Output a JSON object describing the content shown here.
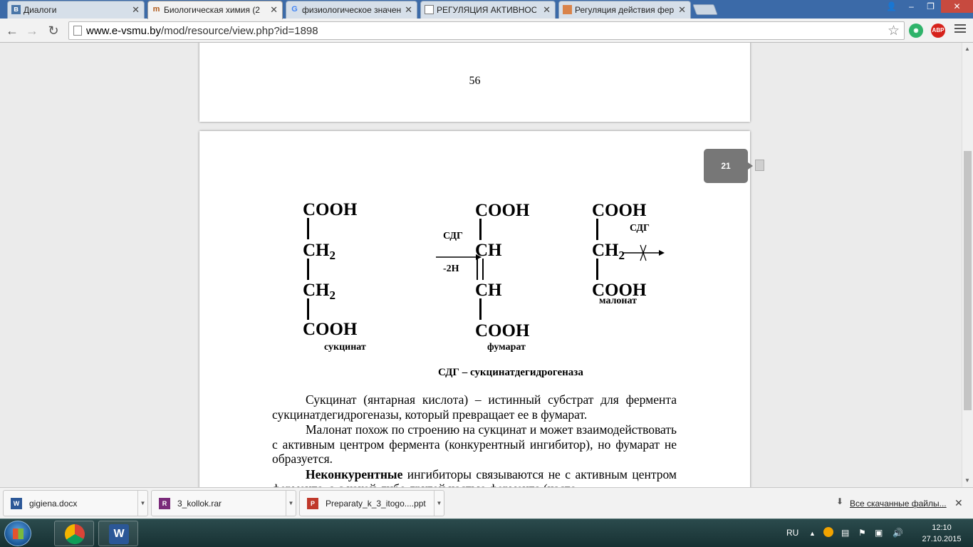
{
  "browser": {
    "tabs": [
      {
        "label": "Диалоги",
        "favicon": "vk-icon",
        "active": false
      },
      {
        "label": "Биологическая химия (2",
        "favicon": "moodle-icon",
        "active": true
      },
      {
        "label": "физиологическое значен",
        "favicon": "google-icon",
        "active": false
      },
      {
        "label": "РЕГУЛЯЦИЯ АКТИВНОСТ",
        "favicon": "document-icon",
        "active": false
      },
      {
        "label": "Регуляция действия фер",
        "favicon": "slides-icon",
        "active": false
      }
    ],
    "url_host": "www.e-vsmu.by",
    "url_path": "/mod/resource/view.php?id=1898",
    "ext_abp": "ABP",
    "window_controls": {
      "user": "👤",
      "minimize": "–",
      "maximize": "❐",
      "close": "✕"
    }
  },
  "document": {
    "prev_page_number": "56",
    "slide_badge": "21",
    "succinate": {
      "line1": "COOH",
      "line2": "CH",
      "line3": "CH",
      "line4": "COOH",
      "sub": "2",
      "label": "сукцинат"
    },
    "reaction": {
      "enzyme": "СДГ",
      "cofactor": "-2H"
    },
    "fumarate": {
      "line1": "COOH",
      "line2": "CH",
      "line3": "CH",
      "line4": "COOH",
      "label": "фумарат"
    },
    "malonate": {
      "line1": "COOH",
      "line2": "CH",
      "sub": "2",
      "line3": "COOH",
      "label": "малонат",
      "enzyme": "СДГ"
    },
    "caption": "СДГ – сукцинатдегидрогеназа",
    "paragraphs": [
      "Сукцинат (янтарная кислота) – истинный субстрат для фермента сукцинатдегидрогеназы, который превращает ее в фумарат.",
      "Малонат похож по строению на сукцинат и может взаимодействовать с активным центром фермента (конкурентный ингибитор), но фумарат не образуется."
    ],
    "para3_bold": "Неконкурентные",
    "para3_rest": " ингибиторы связываются не с активным центром фермента, а с какой-либо другой частью фермента (часто"
  },
  "downloads": {
    "items": [
      {
        "name": "gigiena.docx",
        "icon": "word-icon"
      },
      {
        "name": "3_kollok.rar",
        "icon": "rar-icon"
      },
      {
        "name": "Preparaty_k_3_itogo....ppt",
        "icon": "pdf-icon"
      }
    ],
    "all_label": "Все скачанные файлы...",
    "close": "✕"
  },
  "taskbar": {
    "language": "RU",
    "time": "12:10",
    "date": "27.10.2015"
  },
  "colors": {
    "tab_strip": "#3b6aa8",
    "abp_red": "#d6221b",
    "grammarly_green": "#2fb36a",
    "slide_badge": "#777777"
  }
}
